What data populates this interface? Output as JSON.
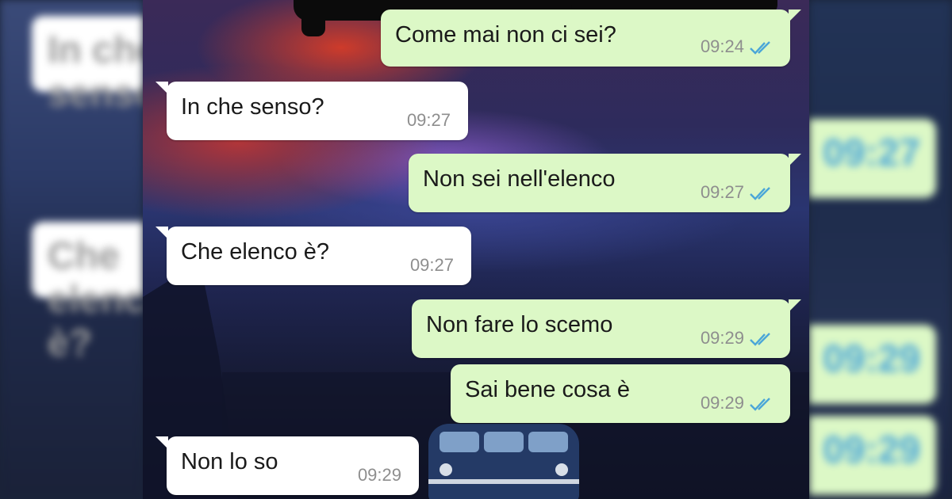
{
  "colors": {
    "incoming_bubble": "#ffffff",
    "outgoing_bubble": "#dcf8c6",
    "read_ticks": "#4aa6d8",
    "timestamp": "#8e8e8e"
  },
  "messages": [
    {
      "direction": "out",
      "text": "Come mai non ci sei?",
      "time": "09:24",
      "status": "read"
    },
    {
      "direction": "in",
      "text": "In che senso?",
      "time": "09:27"
    },
    {
      "direction": "out",
      "text": "Non sei nell'elenco",
      "time": "09:27",
      "status": "read"
    },
    {
      "direction": "in",
      "text": "Che elenco è?",
      "time": "09:27"
    },
    {
      "direction": "out",
      "text": "Non fare lo scemo",
      "time": "09:29",
      "status": "read"
    },
    {
      "direction": "out",
      "text": "Sai bene cosa è",
      "time": "09:29",
      "status": "read"
    },
    {
      "direction": "in",
      "text": "Non lo so",
      "time": "09:29"
    }
  ],
  "icons": {
    "read_status": "double-check-icon"
  }
}
